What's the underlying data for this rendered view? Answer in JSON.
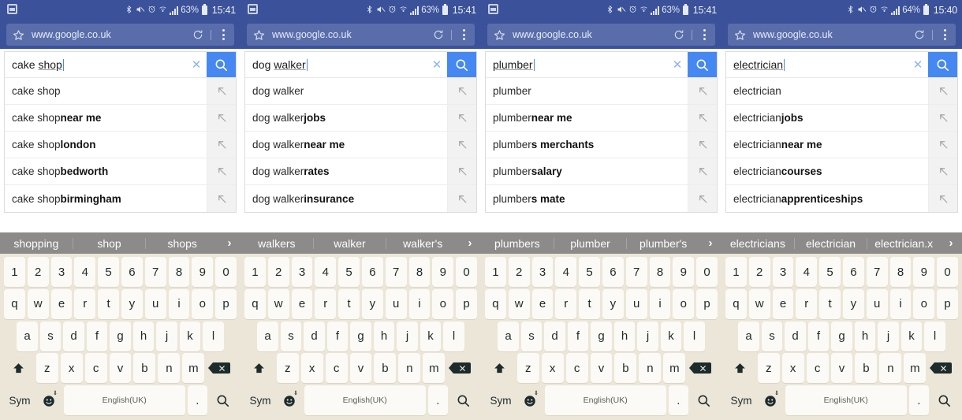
{
  "panels": [
    {
      "status": {
        "battery": "63%",
        "time": "15:41",
        "screenshot_icon": "screenshot-icon",
        "icons": [
          "bluetooth-icon",
          "mute-icon",
          "alarm-icon",
          "wifi-icon",
          "signal-icon"
        ]
      },
      "browser": {
        "url": "www.google.co.uk",
        "star_icon": "bookmark-star-icon",
        "reload_icon": "reload-icon",
        "menu_icon": "overflow-menu-icon"
      },
      "search": {
        "prefix": "cake ",
        "composing": "shop",
        "clear_icon": "clear-icon",
        "go_icon": "search-icon"
      },
      "suggestions": [
        {
          "plain": "cake shop",
          "bold": ""
        },
        {
          "plain": "cake shop ",
          "bold": "near me"
        },
        {
          "plain": "cake shop ",
          "bold": "london"
        },
        {
          "plain": "cake shop ",
          "bold": "bedworth"
        },
        {
          "plain": "cake shop ",
          "bold": "birmingham"
        }
      ],
      "keyboard": {
        "predictions": [
          "shopping",
          "shop",
          "shops"
        ],
        "more_icon": "chevron-right-icon",
        "space_label": "English(UK)",
        "sym_label": "Sym",
        "period_label": ".",
        "go_icon": "search-icon",
        "shift_icon": "shift-icon",
        "backspace_icon": "backspace-icon",
        "emoji_icon": "emoji-icon"
      }
    },
    {
      "status": {
        "battery": "63%",
        "time": "15:41",
        "screenshot_icon": "screenshot-icon",
        "icons": [
          "bluetooth-icon",
          "mute-icon",
          "alarm-icon",
          "wifi-icon",
          "signal-icon"
        ]
      },
      "browser": {
        "url": "www.google.co.uk",
        "star_icon": "bookmark-star-icon",
        "reload_icon": "reload-icon",
        "menu_icon": "overflow-menu-icon"
      },
      "search": {
        "prefix": "dog ",
        "composing": "walker",
        "clear_icon": "clear-icon",
        "go_icon": "search-icon"
      },
      "suggestions": [
        {
          "plain": "dog walker",
          "bold": ""
        },
        {
          "plain": "dog walker ",
          "bold": "jobs"
        },
        {
          "plain": "dog walker ",
          "bold": "near me"
        },
        {
          "plain": "dog walker ",
          "bold": "rates"
        },
        {
          "plain": "dog walker ",
          "bold": "insurance"
        }
      ],
      "keyboard": {
        "predictions": [
          "walkers",
          "walker",
          "walker's"
        ],
        "more_icon": "chevron-right-icon",
        "space_label": "English(UK)",
        "sym_label": "Sym",
        "period_label": ".",
        "go_icon": "search-icon",
        "shift_icon": "shift-icon",
        "backspace_icon": "backspace-icon",
        "emoji_icon": "emoji-icon"
      }
    },
    {
      "status": {
        "battery": "63%",
        "time": "15:41",
        "screenshot_icon": "screenshot-icon",
        "icons": [
          "bluetooth-icon",
          "mute-icon",
          "alarm-icon",
          "wifi-icon",
          "signal-icon"
        ]
      },
      "browser": {
        "url": "www.google.co.uk",
        "star_icon": "bookmark-star-icon",
        "reload_icon": "reload-icon",
        "menu_icon": "overflow-menu-icon"
      },
      "search": {
        "prefix": "",
        "composing": "plumber",
        "clear_icon": "clear-icon",
        "go_icon": "search-icon"
      },
      "suggestions": [
        {
          "plain": "plumber",
          "bold": ""
        },
        {
          "plain": "plumber ",
          "bold": "near me"
        },
        {
          "plain": "plumber",
          "bold": "s merchants"
        },
        {
          "plain": "plumber ",
          "bold": "salary"
        },
        {
          "plain": "plumber",
          "bold": "s mate"
        }
      ],
      "keyboard": {
        "predictions": [
          "plumbers",
          "plumber",
          "plumber's"
        ],
        "more_icon": "chevron-right-icon",
        "space_label": "English(UK)",
        "sym_label": "Sym",
        "period_label": ".",
        "go_icon": "search-icon",
        "shift_icon": "shift-icon",
        "backspace_icon": "backspace-icon",
        "emoji_icon": "emoji-icon"
      }
    },
    {
      "status": {
        "battery": "64%",
        "time": "15:40",
        "screenshot_icon": "",
        "icons": [
          "bluetooth-icon",
          "mute-icon",
          "alarm-icon",
          "wifi-icon",
          "signal-icon"
        ]
      },
      "browser": {
        "url": "www.google.co.uk",
        "star_icon": "bookmark-star-icon",
        "reload_icon": "reload-icon",
        "menu_icon": "overflow-menu-icon"
      },
      "search": {
        "prefix": "",
        "composing": "electrician",
        "clear_icon": "clear-icon",
        "go_icon": "search-icon"
      },
      "suggestions": [
        {
          "plain": "electrician",
          "bold": ""
        },
        {
          "plain": "electrician ",
          "bold": "jobs"
        },
        {
          "plain": "electrician ",
          "bold": "near me"
        },
        {
          "plain": "electrician ",
          "bold": "courses"
        },
        {
          "plain": "electrician ",
          "bold": "apprenticeships"
        }
      ],
      "keyboard": {
        "predictions": [
          "electricians",
          "electrician",
          "electrician.x"
        ],
        "more_icon": "chevron-right-icon",
        "space_label": "English(UK)",
        "sym_label": "Sym",
        "period_label": ".",
        "go_icon": "search-icon",
        "shift_icon": "shift-icon",
        "backspace_icon": "backspace-icon",
        "emoji_icon": "emoji-icon"
      }
    }
  ],
  "keyboard_layout": {
    "row_numbers": [
      "1",
      "2",
      "3",
      "4",
      "5",
      "6",
      "7",
      "8",
      "9",
      "0"
    ],
    "row_top": [
      "q",
      "w",
      "e",
      "r",
      "t",
      "y",
      "u",
      "i",
      "o",
      "p"
    ],
    "row_home": [
      "a",
      "s",
      "d",
      "f",
      "g",
      "h",
      "j",
      "k",
      "l"
    ],
    "row_bottom": [
      "z",
      "x",
      "c",
      "v",
      "b",
      "n",
      "m"
    ]
  },
  "colors": {
    "status_bar": "#3b5199",
    "url_bar_field": "#5a6dab",
    "accent_blue": "#4688f1",
    "keyboard_bg": "#ece6d8",
    "key_bg": "#fbfaf6",
    "prediction_bar": "#8d8a8a"
  }
}
